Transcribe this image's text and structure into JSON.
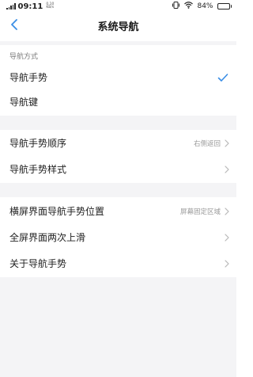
{
  "status_bar": {
    "time": "09:11",
    "speed_value": "0.10",
    "speed_unit": "KB/s",
    "battery_percent": "84%",
    "battery_level": 0.84,
    "icons": [
      "signal-icon",
      "vibrate-icon",
      "wifi-icon",
      "battery-icon"
    ]
  },
  "header": {
    "title": "系统导航",
    "back_icon": "back-chevron-icon"
  },
  "nav_method": {
    "section_label": "导航方式",
    "options": [
      {
        "label": "导航手势",
        "selected": true
      },
      {
        "label": "导航键",
        "selected": false
      }
    ],
    "accent_color": "#3a8ee6"
  },
  "gesture_settings": [
    {
      "label": "导航手势顺序",
      "value": "右侧返回"
    },
    {
      "label": "导航手势样式",
      "value": ""
    }
  ],
  "more_settings": [
    {
      "label": "横屏界面导航手势位置",
      "value": "屏幕固定区域"
    },
    {
      "label": "全屏界面两次上滑",
      "value": ""
    },
    {
      "label": "关于导航手势",
      "value": ""
    }
  ]
}
